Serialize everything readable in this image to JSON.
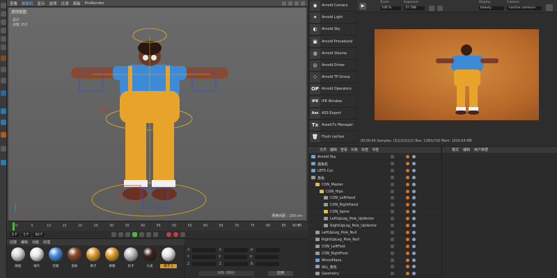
{
  "viewport": {
    "menu": [
      "查看",
      "摄像机",
      "显示",
      "选项",
      "过滤",
      "面板",
      "ProRender"
    ],
    "active_menu_index": 1,
    "camera_label": "透视视图",
    "info": {
      "label1": "总计",
      "label2": "对象",
      "value": "153"
    },
    "grid_spacing": "网格间距 : 100 cm"
  },
  "timeline": {
    "start": "0",
    "ticks": [
      "0",
      "5",
      "10",
      "15",
      "20",
      "25",
      "30",
      "35",
      "40",
      "45",
      "50",
      "55",
      "60",
      "65",
      "70",
      "75",
      "80",
      "85",
      "90"
    ],
    "frame_end": "90 F"
  },
  "transport": {
    "current": "0 F",
    "min": "0 F",
    "max": "90 F"
  },
  "materials": {
    "menu": [
      "创建",
      "编辑",
      "功能",
      "纹理"
    ],
    "items": [
      {
        "label": "眼框",
        "color": "#d8d8d8"
      },
      {
        "label": "眼片",
        "color": "#e8e8e8"
      },
      {
        "label": "衣服",
        "color": "#4a8ee0"
      },
      {
        "label": "皮肤",
        "color": "#8a4a2a"
      },
      {
        "label": "裤子",
        "color": "#e0a030"
      },
      {
        "label": "裤腰",
        "color": "#e0a030"
      },
      {
        "label": "扣子",
        "color": "#c0c0c0"
      },
      {
        "label": "头发",
        "color": "#3a2418"
      },
      {
        "label": "裤子.1",
        "color": "#e8e8e8"
      }
    ],
    "selected_index": 8
  },
  "coords": {
    "rows": [
      [
        "X",
        "X",
        "H"
      ],
      [
        "Y",
        "Y",
        "P"
      ],
      [
        "Z",
        "Z",
        "B"
      ]
    ],
    "mode": "对象 (相对)",
    "apply": "应用"
  },
  "arnold_menu": [
    {
      "label": "Arnold Camera",
      "icon": "camera-icon",
      "glyph": "◉"
    },
    {
      "label": "Arnold Light",
      "icon": "light-icon",
      "glyph": "✦"
    },
    {
      "label": "Arnold Sky",
      "icon": "sky-icon",
      "glyph": "◐"
    },
    {
      "label": "Arnold Procedural",
      "icon": "procedural-icon",
      "glyph": "▣"
    },
    {
      "label": "Arnold Volume",
      "icon": "volume-icon",
      "glyph": "◍"
    },
    {
      "label": "Arnold Driver",
      "icon": "driver-icon",
      "glyph": "◎"
    },
    {
      "label": "Arnold TP Group",
      "icon": "tp-group-icon",
      "glyph": "⁘"
    },
    {
      "label": "Arnold Operators",
      "icon": "operators-icon",
      "glyph": "OP"
    },
    {
      "label": "IPR Window",
      "icon": "ipr-icon",
      "glyph": "IPR"
    },
    {
      "label": "ASS Export",
      "icon": "ass-export-icon",
      "glyph": "Ass"
    },
    {
      "label": "Asset/Tx Manager",
      "icon": "tx-manager-icon",
      "glyph": "Tx"
    },
    {
      "label": "Flush caches",
      "icon": "trash-icon",
      "glyph": "🗑"
    }
  ],
  "render_view": {
    "zoom_label": "Zoom",
    "zoom_value": "100 %",
    "exposure_label": "Exposure",
    "exposure_value": "37.788",
    "display_label": "Display",
    "display_value": "beauty",
    "camera_label": "Camera",
    "camera_value": "<active camera>",
    "status": "00:00:04  Samples: [3/2/2/2/2/2]  Res: 1280x720  Mem: 1026.64 MB"
  },
  "object_manager": {
    "menu": [
      "文件",
      "编辑",
      "查看",
      "对象",
      "标签",
      "书签"
    ],
    "rows": [
      {
        "name": "Arnold Sky",
        "indent": 0,
        "icon_color": "#6aa0e0"
      },
      {
        "name": "摄像机",
        "indent": 0,
        "icon_color": "#6aa0e0"
      },
      {
        "name": "LEFS Cyc",
        "indent": 0,
        "icon_color": "#6aa0e0"
      },
      {
        "name": "角色",
        "indent": 0,
        "icon_color": "#9a9a9a"
      },
      {
        "name": "CON_Master",
        "indent": 1,
        "icon_color": "#e0c040"
      },
      {
        "name": "CON_Hips",
        "indent": 2,
        "icon_color": "#e0c040"
      },
      {
        "name": "CON_LeftHand",
        "indent": 3,
        "icon_color": "#9a9a9a"
      },
      {
        "name": "CON_RightHand",
        "indent": 3,
        "icon_color": "#9a9a9a"
      },
      {
        "name": "CON_Spine",
        "indent": 3,
        "icon_color": "#e0c040"
      },
      {
        "name": "LeftUpLeg_Pole_UpVector",
        "indent": 3,
        "icon_color": "#9a9a9a"
      },
      {
        "name": "RightUpLeg_Pole_UpVector",
        "indent": 3,
        "icon_color": "#9a9a9a"
      },
      {
        "name": "LeftUpLeg_Pole_Null",
        "indent": 1,
        "icon_color": "#9a9a9a"
      },
      {
        "name": "RightUpLeg_Pole_Null",
        "indent": 1,
        "icon_color": "#9a9a9a"
      },
      {
        "name": "CON_LeftFoot",
        "indent": 1,
        "icon_color": "#9a9a9a"
      },
      {
        "name": "CON_RightFoot",
        "indent": 1,
        "icon_color": "#9a9a9a"
      },
      {
        "name": "MirrorPlane",
        "indent": 1,
        "icon_color": "#6aa0e0"
      },
      {
        "name": "SKL_角色",
        "indent": 1,
        "icon_color": "#9a9a9a"
      },
      {
        "name": "Geometry",
        "indent": 1,
        "icon_color": "#9a9a9a"
      }
    ]
  },
  "attribute_manager": {
    "menu": [
      "模式",
      "编辑",
      "用户数据"
    ]
  }
}
